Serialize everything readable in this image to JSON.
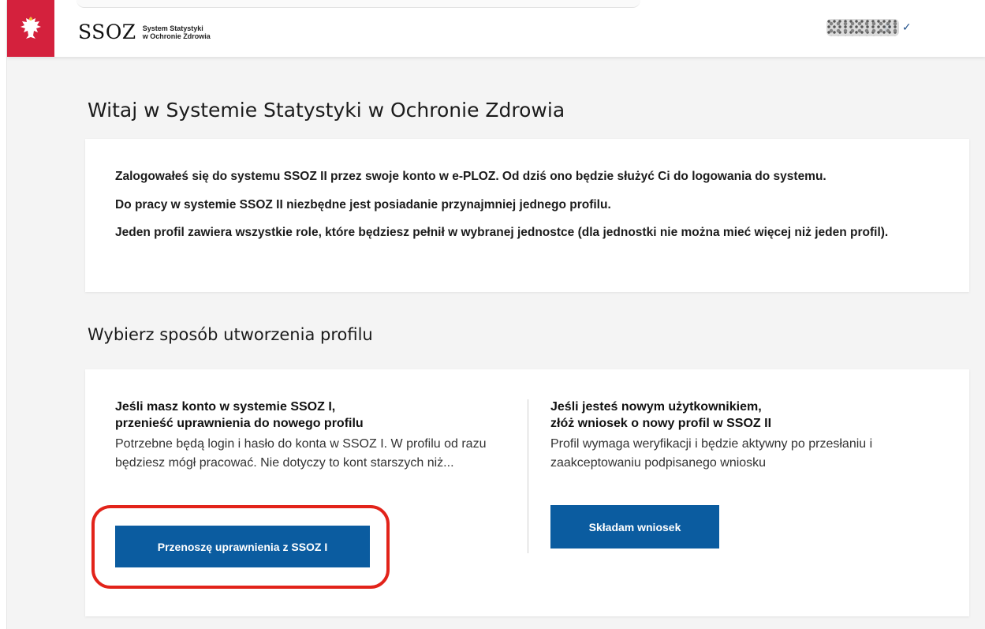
{
  "header": {
    "logo_main": "SSOZ",
    "logo_sub_line1": "System Statystyki",
    "logo_sub_line2": "w Ochronie Zdrowia",
    "user_name": "P",
    "accent_color": "#d4213d",
    "user_color": "#1f4f8a"
  },
  "page": {
    "title": "Witaj w Systemie Statystyki w Ochronie Zdrowia"
  },
  "info": {
    "line1": "Zalogowałeś się do systemu SSOZ II przez swoje konto w e-PLOZ. Od dziś ono będzie służyć Ci do logowania do systemu.",
    "line2": "Do pracy w systemie SSOZ II niezbędne jest posiadanie przynajmniej jednego profilu.",
    "line3": "Jeden profil zawiera wszystkie role, które będziesz pełnił w wybranej jednostce (dla jednostki nie można mieć więcej niż jeden profil)."
  },
  "profile_section": {
    "title": "Wybierz sposób utworzenia profilu",
    "left": {
      "title_line1": "Jeśli masz konto w systemie SSOZ I,",
      "title_line2": "przenieść uprawnienia do nowego profilu",
      "description": "Potrzebne będą login i hasło do konta w SSOZ I. W profilu od razu będziesz mógł pracować. Nie dotyczy to kont starszych niż...",
      "button_label": "Przenoszę uprawnienia z SSOZ I"
    },
    "right": {
      "title_line1": "Jeśli jesteś nowym użytkownikiem,",
      "title_line2": "złóż wniosek o nowy profil w SSOZ II",
      "description": "Profil wymaga weryfikacji i będzie aktywny po przesłaniu i zaakceptowaniu podpisanego wniosku",
      "button_label": "Składam wniosek"
    }
  },
  "colors": {
    "primary_button": "#0b5ca0",
    "highlight": "#e2231a"
  }
}
